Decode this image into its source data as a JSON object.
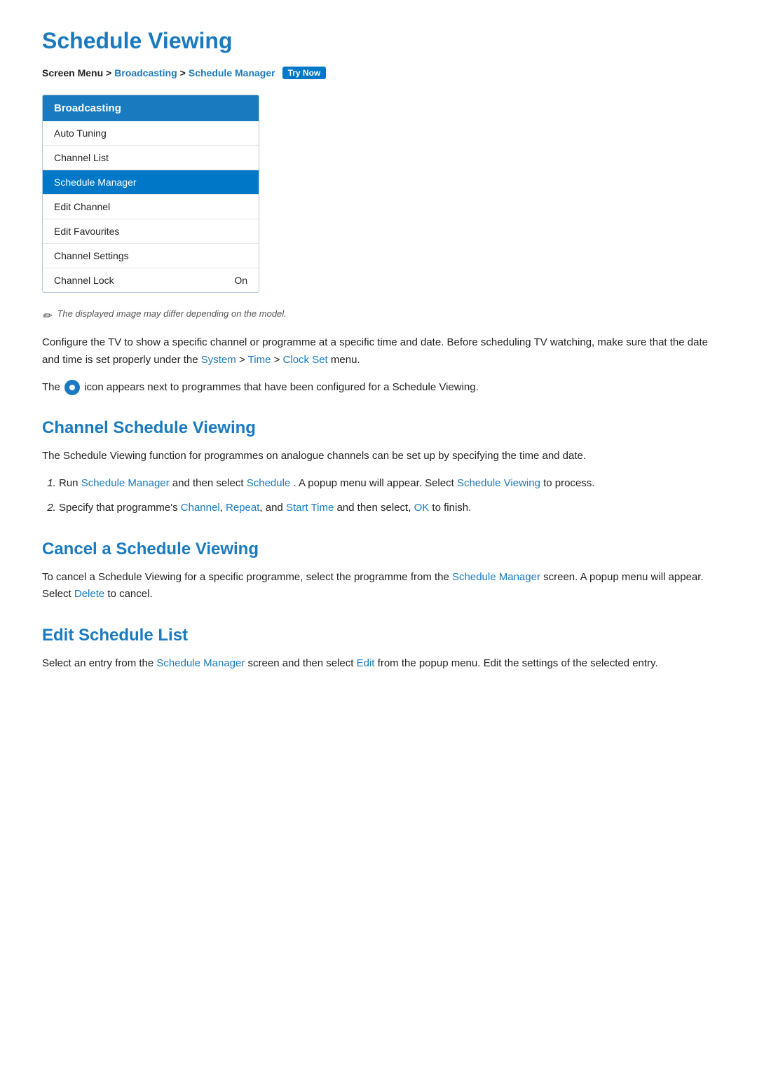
{
  "page": {
    "title": "Schedule Viewing",
    "breadcrumb": {
      "prefix": "Screen Menu >",
      "item1": "Broadcasting",
      "separator1": ">",
      "item2": "Schedule Manager",
      "badge": "Try Now"
    },
    "menu": {
      "header": "Broadcasting",
      "items": [
        {
          "label": "Auto Tuning",
          "active": false,
          "value": ""
        },
        {
          "label": "Channel List",
          "active": false,
          "value": ""
        },
        {
          "label": "Schedule Manager",
          "active": true,
          "value": ""
        },
        {
          "label": "Edit Channel",
          "active": false,
          "value": ""
        },
        {
          "label": "Edit Favourites",
          "active": false,
          "value": ""
        },
        {
          "label": "Channel Settings",
          "active": false,
          "value": ""
        },
        {
          "label": "Channel Lock",
          "active": false,
          "value": "On"
        }
      ]
    },
    "note": "The displayed image may differ depending on the model.",
    "intro": {
      "para1": "Configure the TV to show a specific channel or programme at a specific time and date. Before scheduling TV watching, make sure that the date and time is set properly under the",
      "link1": "System",
      "sep1": ">",
      "link2": "Time",
      "sep2": ">",
      "link3": "Clock Set",
      "para1_end": "menu.",
      "para2_prefix": "The",
      "para2_suffix": "icon appears next to programmes that have been configured for a Schedule Viewing."
    },
    "section1": {
      "heading": "Channel Schedule Viewing",
      "body": "The Schedule Viewing function for programmes on analogue channels can be set up by specifying the time and date.",
      "steps": [
        {
          "text_prefix": "Run",
          "link1": "Schedule Manager",
          "text_mid1": "and then select",
          "link2": "Schedule",
          "text_mid2": ". A popup menu will appear. Select",
          "link3": "Schedule Viewing",
          "text_end": "to process."
        },
        {
          "text_prefix": "Specify that programme's",
          "link1": "Channel",
          "sep1": ",",
          "link2": "Repeat",
          "sep2": ", and",
          "link3": "Start Time",
          "text_mid": "and then select,",
          "link4": "OK",
          "text_end": "to finish."
        }
      ]
    },
    "section2": {
      "heading": "Cancel a Schedule Viewing",
      "body_prefix": "To cancel a Schedule Viewing for a specific programme, select the programme from the",
      "link1": "Schedule Manager",
      "body_mid": "screen. A popup menu will appear. Select",
      "link2": "Delete",
      "body_end": "to cancel."
    },
    "section3": {
      "heading": "Edit Schedule List",
      "body_prefix": "Select an entry from the",
      "link1": "Schedule Manager",
      "body_mid": "screen and then select",
      "link2": "Edit",
      "body_end": "from the popup menu. Edit the settings of the selected entry."
    }
  }
}
